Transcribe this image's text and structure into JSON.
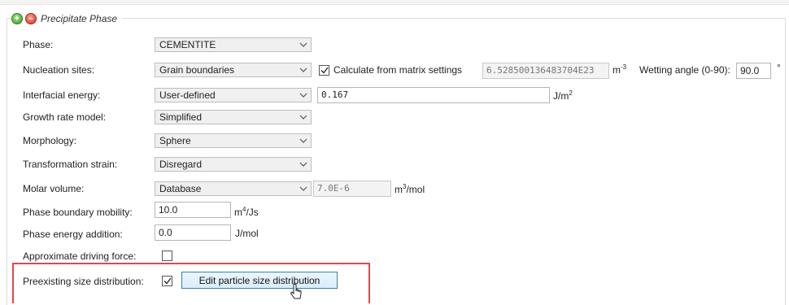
{
  "header": {
    "group_title": "Precipitate Phase",
    "add_icon": "add-icon",
    "remove_icon": "remove-icon"
  },
  "form": {
    "phase": {
      "label": "Phase:",
      "value": "CEMENTITE"
    },
    "nucleation_sites": {
      "label": "Nucleation sites:",
      "value": "Grain boundaries",
      "calc_from_matrix_label": "Calculate from matrix settings",
      "calc_from_matrix_checked": true,
      "density_value": "6.528500136483704E23",
      "density_unit_prefix": "m",
      "density_unit_exp": "-3",
      "wetting_label": "Wetting angle (0-90):",
      "wetting_value": "90.0",
      "wetting_unit": "°"
    },
    "interfacial_energy": {
      "label": "Interfacial energy:",
      "value": "User-defined",
      "input_value": "0.167",
      "unit_prefix": "J/m",
      "unit_exp": "2"
    },
    "growth_rate_model": {
      "label": "Growth rate model:",
      "value": "Simplified"
    },
    "morphology": {
      "label": "Morphology:",
      "value": "Sphere"
    },
    "transformation_strain": {
      "label": "Transformation strain:",
      "value": "Disregard"
    },
    "molar_volume": {
      "label": "Molar volume:",
      "value": "Database",
      "input_value": "7.0E-6",
      "unit_prefix": "m",
      "unit_exp": "3",
      "unit_suffix": "/mol"
    },
    "phase_boundary_mobility": {
      "label": "Phase boundary mobility:",
      "input_value": "10.0",
      "unit_prefix": "m",
      "unit_exp": "4",
      "unit_suffix": "/Js"
    },
    "phase_energy_addition": {
      "label": "Phase energy addition:",
      "input_value": "0.0",
      "unit": "J/mol"
    },
    "approximate_driving_force": {
      "label": "Approximate driving force:",
      "checked": false
    },
    "preexisting_size_distribution": {
      "label": "Preexisting size distribution:",
      "checked": true,
      "button_label": "Edit particle size distribution"
    }
  },
  "colors": {
    "highlight": "#e0484b",
    "button_border": "#3c7fb1",
    "combo_bg": "#f0f0f0"
  }
}
